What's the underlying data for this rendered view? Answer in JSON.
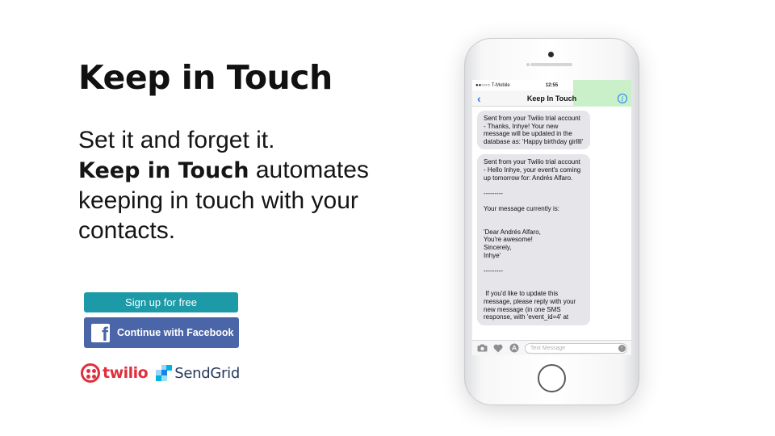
{
  "hero": {
    "title": "Keep in Touch",
    "line1": "Set it and forget it.",
    "line2_bold": "Keep in Touch",
    "line2_rest": " automates",
    "line3": "keeping in touch with your",
    "line4": "contacts."
  },
  "actions": {
    "signup_label": "Sign up for free",
    "facebook_label": "Continue with Facebook",
    "facebook_icon": "f"
  },
  "logos": {
    "twilio": "twilio",
    "sendgrid": "SendGrid"
  },
  "phone": {
    "status": {
      "carrier": "●●○○○ T-Mobile ",
      "time": "12:55",
      "icons": "◎ ✱"
    },
    "nav": {
      "back": "‹",
      "title": "Keep In Touch",
      "info": "i"
    },
    "messages": [
      "Sent from your Twilio trial account - Thanks, Inhye! Your new message will be updated in the database as: 'Happy birthday girllll'",
      "Sent from your Twilio trial account - Hello Inhye, your event's coming up tomorrow for: Andrés Alfaro.\n\n---------\n\nYour message currently is:\n\n\n'Dear Andrés Alfaro,\nYou're awesome!\nSincerely,\nInhye'\n\n---------\n\n\n If you'd like to update this message, please reply with your new message (in one SMS response, with 'event_id=4' at"
    ],
    "input": {
      "placeholder": "Text Message"
    }
  },
  "colors": {
    "signup_bg": "#1c9aa7",
    "facebook_bg": "#4a66a8",
    "twilio_red": "#e02f3c",
    "sendgrid_navy": "#263959",
    "ios_blue": "#1e7bf2"
  }
}
